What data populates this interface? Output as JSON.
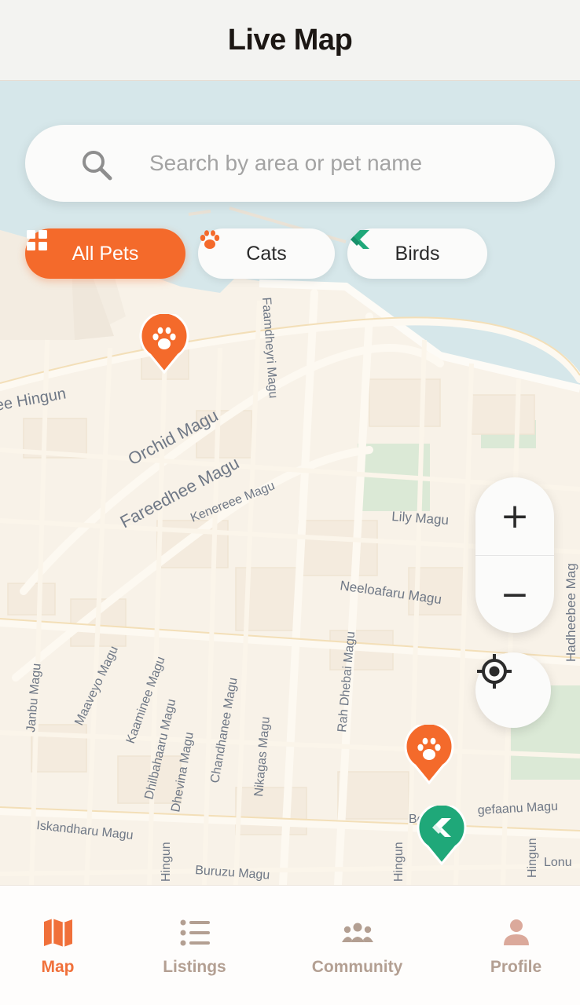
{
  "header": {
    "title": "Live Map"
  },
  "search": {
    "placeholder": "Search by area or pet name"
  },
  "filters": [
    {
      "label": "All Pets",
      "icon": "grid-icon",
      "active": true
    },
    {
      "label": "Cats",
      "icon": "paw-icon",
      "active": false
    },
    {
      "label": "Birds",
      "icon": "bird-icon",
      "active": false
    }
  ],
  "map": {
    "streets": [
      "ee Hingun",
      "Orchid Magu",
      "Fareedhee Magu",
      "Kenereee Magu",
      "Faamdheyri Magu",
      "Lily Magu",
      "Neeloafaru Magu",
      "Hadheebee Mag",
      "Janbu Magu",
      "Maaveyo Magu",
      "Kaaminee Magu",
      "Dhilbahaaru Magu",
      "Dhevina Magu",
      "Chandhanee Magu",
      "Nikagas Magu",
      "Rah Dhebai Magu",
      "Iskandharu Magu",
      "Buruzu Magu",
      "Hingun",
      "Bodu",
      "gefaanu Magu",
      "Hingun",
      "Hingun",
      "Lonu"
    ]
  },
  "controls": {
    "zoom_in": "+",
    "zoom_out": "−"
  },
  "nav": [
    {
      "label": "Map",
      "icon": "map-icon",
      "active": true
    },
    {
      "label": "Listings",
      "icon": "list-icon",
      "active": false
    },
    {
      "label": "Community",
      "icon": "community-icon",
      "active": false
    },
    {
      "label": "Profile",
      "icon": "profile-icon",
      "active": false
    }
  ],
  "colors": {
    "accent": "#f46a2b",
    "bird": "#1fa879",
    "water": "#d6e7ea",
    "land": "#f8f2e8"
  }
}
